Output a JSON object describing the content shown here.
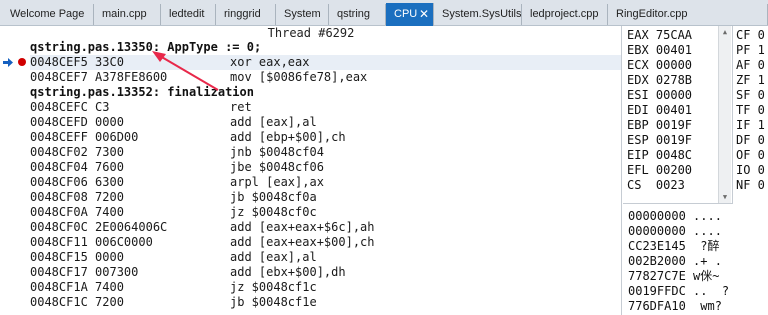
{
  "tabs": [
    {
      "label": "Welcome Page",
      "active": false
    },
    {
      "label": "main.cpp",
      "active": false
    },
    {
      "label": "ledtedit",
      "active": false
    },
    {
      "label": "ringgrid",
      "active": false
    },
    {
      "label": "System",
      "active": false
    },
    {
      "label": "qstring",
      "active": false
    },
    {
      "label": "CPU",
      "active": true
    },
    {
      "label": "System.SysUtils",
      "active": false
    },
    {
      "label": "ledproject.cpp",
      "active": false
    },
    {
      "label": "RingEditor.cpp",
      "active": false
    }
  ],
  "tab_close_glyph": "✕",
  "disasm": {
    "thread_title": "Thread #6292",
    "lines": [
      {
        "kind": "source",
        "text": "qstring.pas.13350: AppType := 0;"
      },
      {
        "kind": "instr",
        "addr": "0048CEF5 33C0",
        "asm": "xor eax,eax",
        "breakpoint": true,
        "current_ip": true
      },
      {
        "kind": "instr",
        "addr": "0048CEF7 A378FE8600",
        "asm": "mov [$0086fe78],eax"
      },
      {
        "kind": "source",
        "text": "qstring.pas.13352: finalization"
      },
      {
        "kind": "instr",
        "addr": "0048CEFC C3",
        "asm": "ret"
      },
      {
        "kind": "instr",
        "addr": "0048CEFD 0000",
        "asm": "add [eax],al"
      },
      {
        "kind": "instr",
        "addr": "0048CEFF 006D00",
        "asm": "add [ebp+$00],ch"
      },
      {
        "kind": "instr",
        "addr": "0048CF02 7300",
        "asm": "jnb $0048cf04"
      },
      {
        "kind": "instr",
        "addr": "0048CF04 7600",
        "asm": "jbe $0048cf06"
      },
      {
        "kind": "instr",
        "addr": "0048CF06 6300",
        "asm": "arpl [eax],ax"
      },
      {
        "kind": "instr",
        "addr": "0048CF08 7200",
        "asm": "jb $0048cf0a"
      },
      {
        "kind": "instr",
        "addr": "0048CF0A 7400",
        "asm": "jz $0048cf0c"
      },
      {
        "kind": "instr",
        "addr": "0048CF0C 2E0064006C",
        "asm": "add [eax+eax+$6c],ah"
      },
      {
        "kind": "instr",
        "addr": "0048CF11 006C0000",
        "asm": "add [eax+eax+$00],ch"
      },
      {
        "kind": "instr",
        "addr": "0048CF15 0000",
        "asm": "add [eax],al"
      },
      {
        "kind": "instr",
        "addr": "0048CF17 007300",
        "asm": "add [ebx+$00],dh"
      },
      {
        "kind": "instr",
        "addr": "0048CF1A 7400",
        "asm": "jz $0048cf1c"
      },
      {
        "kind": "instr",
        "addr": "0048CF1C 7200",
        "asm": "jb $0048cf1e"
      }
    ]
  },
  "registers": [
    {
      "line": "EAX 75CAA"
    },
    {
      "line": "EBX 00401"
    },
    {
      "line": "ECX 00000"
    },
    {
      "line": "EDX 0278B"
    },
    {
      "line": "ESI 00000"
    },
    {
      "line": "EDI 00401"
    },
    {
      "line": "EBP 0019F"
    },
    {
      "line": "ESP 0019F"
    },
    {
      "line": "EIP 0048C"
    },
    {
      "line": "EFL 00200"
    },
    {
      "line": "CS  0023"
    }
  ],
  "flags": [
    {
      "line": "CF 0"
    },
    {
      "line": "PF 1"
    },
    {
      "line": "AF 0"
    },
    {
      "line": "ZF 1"
    },
    {
      "line": "SF 0"
    },
    {
      "line": "TF 0"
    },
    {
      "line": "IF 1"
    },
    {
      "line": "DF 0"
    },
    {
      "line": "OF 0"
    },
    {
      "line": "IO 0"
    },
    {
      "line": "NF 0"
    }
  ],
  "stack": [
    {
      "line": "00000000 ...."
    },
    {
      "line": "00000000 ...."
    },
    {
      "line": "CC23E145  ?醉"
    },
    {
      "line": "002B2000 .+ ."
    },
    {
      "line": "77827C7E w侎~"
    },
    {
      "line": "0019FFDC ..  ?"
    },
    {
      "line": "776DFA10  wm?"
    }
  ],
  "colors": {
    "active_tab": "#1b6fbf",
    "breakpoint": "#d00000",
    "annotation_arrow": "#e8284a"
  },
  "icons": {
    "breakpoint": "breakpoint-icon",
    "instruction_pointer": "instruction-pointer-arrow-icon",
    "tab_close": "close-icon",
    "annotation": "annotation-arrow"
  }
}
